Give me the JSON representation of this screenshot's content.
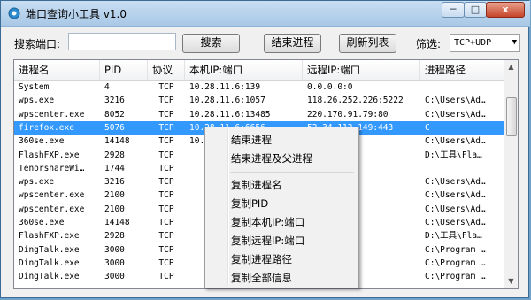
{
  "window": {
    "title": "端口查询小工具  v1.0",
    "controls": {
      "minimize": "─",
      "maximize": "□",
      "close": "x"
    }
  },
  "toolbar": {
    "search_label": "搜索端口:",
    "search_value": "",
    "search_button": "搜索",
    "end_process_button": "结束进程",
    "refresh_button": "刷新列表",
    "filter_label": "筛选:",
    "filter_value": "TCP+UDP"
  },
  "table": {
    "headers": [
      "进程名",
      "PID",
      "协议",
      "本机IP:端口",
      "远程IP:端口",
      "进程路径"
    ],
    "rows": [
      [
        "System",
        "4",
        "TCP",
        "10.28.11.6:139",
        "0.0.0.0:0",
        ""
      ],
      [
        "wps.exe",
        "3216",
        "TCP",
        "10.28.11.6:1057",
        "118.26.252.226:5222",
        "C:\\Users\\Ad…"
      ],
      [
        "wpscenter.exe",
        "8052",
        "TCP",
        "10.28.11.6:13485",
        "220.170.91.79:80",
        "C:\\Users\\Ad…"
      ],
      [
        "firefox.exe",
        "5076",
        "TCP",
        "10.28.11.6:6656",
        "52.34.112.149:443",
        "C"
      ],
      [
        "360se.exe",
        "14148",
        "TCP",
        "10.28.11.6:5658",
        "",
        "C:\\Users\\Ad…"
      ],
      [
        "FlashFXP.exe",
        "2928",
        "TCP",
        "",
        "150:19000",
        "D:\\工具\\Fla…"
      ],
      [
        "TenorshareWi…",
        "1744",
        "TCP",
        "",
        ":443",
        ""
      ],
      [
        "wps.exe",
        "3216",
        "TCP",
        "",
        ":443",
        "C:\\Users\\Ad…"
      ],
      [
        "wpscenter.exe",
        "2100",
        "TCP",
        "",
        "8.227:443",
        "C:\\Users\\Ad…"
      ],
      [
        "wpscenter.exe",
        "2100",
        "TCP",
        "",
        "5.222:443",
        "C:\\Users\\Ad…"
      ],
      [
        "360se.exe",
        "14148",
        "TCP",
        "",
        "89:443",
        "C:\\Users\\Ad…"
      ],
      [
        "FlashFXP.exe",
        "2928",
        "TCP",
        "",
        "90:443",
        "D:\\工具\\Fla…"
      ],
      [
        "DingTalk.exe",
        "3000",
        "TCP",
        "",
        "27:443",
        "C:\\Program …"
      ],
      [
        "DingTalk.exe",
        "3000",
        "TCP",
        "",
        "27:443",
        "C:\\Program …"
      ],
      [
        "DingTalk.exe",
        "3000",
        "TCP",
        "",
        "27:443",
        "C:\\Program …"
      ]
    ]
  },
  "context_menu": {
    "items": [
      "结束进程",
      "结束进程及父进程",
      "复制进程名",
      "复制PID",
      "复制本机IP:端口",
      "复制远程IP:端口",
      "复制进程路径",
      "复制全部信息"
    ]
  },
  "icons": {
    "app": "network-port-icon",
    "dropdown": "chevron-down-icon",
    "scroll_up": "arrow-up-icon",
    "scroll_down": "arrow-down-icon"
  },
  "colors": {
    "selection": "#3399ff",
    "titlebar": "#a9c8e6",
    "close_button": "#c7442a"
  }
}
